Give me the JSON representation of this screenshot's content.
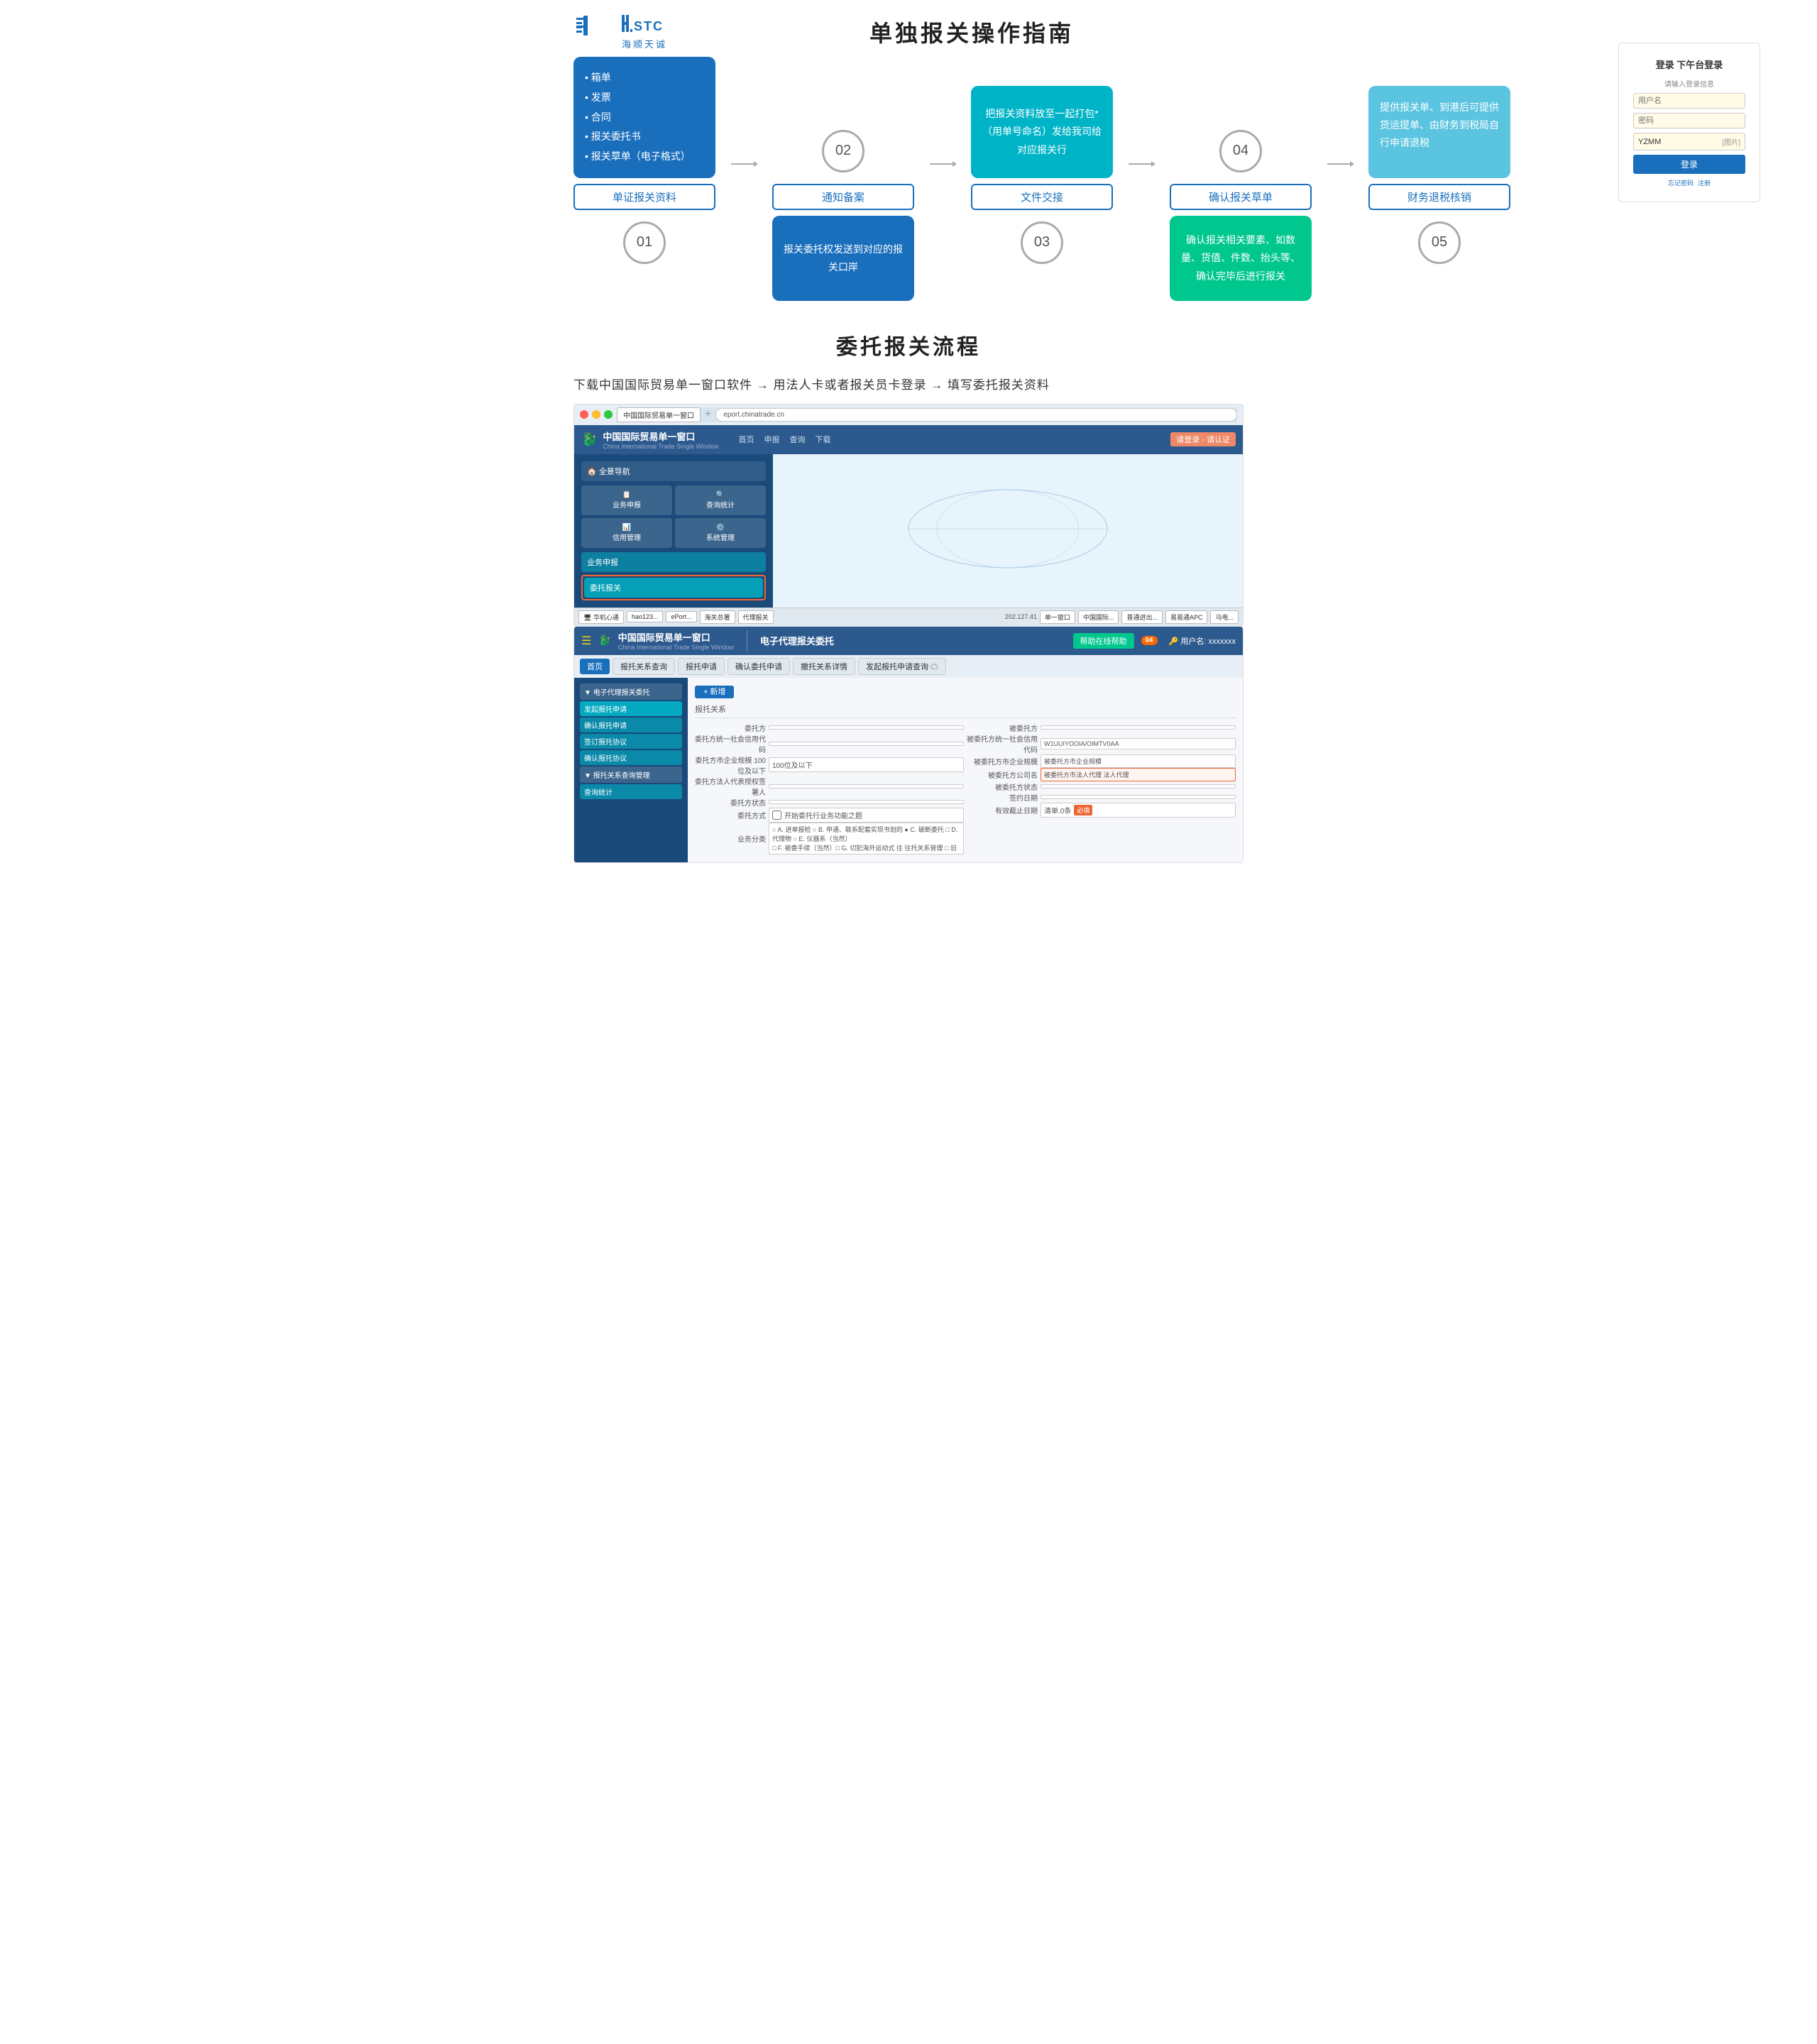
{
  "header": {
    "logo_stc": "H.STC",
    "logo_chinese": "海顺天诚",
    "main_title": "单独报关操作指南"
  },
  "flow": {
    "step1": {
      "num": "01",
      "label": "单证报关资料",
      "card_items": [
        "箱单",
        "发票",
        "合同",
        "报关委托书",
        "报关草单（电子格式）"
      ]
    },
    "step2": {
      "num": "02",
      "label": "通知备案",
      "card_text": "报关委托权发送到对应的报关口岸"
    },
    "step3": {
      "num": "03",
      "label": "文件交接",
      "card_text": "把报关资料放至一起打包*（用单号命名）发给我司给对应报关行"
    },
    "step4": {
      "num": "04",
      "label": "确认报关草单",
      "card_text": "确认报关相关要素、如数量、货值、件数、抬头等、确认完毕后进行报关"
    },
    "step5": {
      "num": "05",
      "label": "财务退税核销",
      "card_text": "提供报关单、到港后可提供货运提单、由财务到税局自行申请退税"
    }
  },
  "section2": {
    "title": "委托报关流程",
    "subtitle": "下载中国国际贸易单一窗口软件 → 用法人卡或者报关员卡登录 → 填写委托报关资料",
    "screen1": {
      "nav_title": "中国国际贸易单一窗口",
      "nav_subtitle": "China International Trade Single Window",
      "login_title": "登录登录 下午台登录",
      "field1_placeholder": "YZMM",
      "btn_text": "登录"
    },
    "screen2": {
      "nav_title": "中国国际贸易单一窗口",
      "nav_subtitle": "电子代理报关委托",
      "tab1": "首页",
      "tab2": "报托关系查询",
      "tab3": "报托申请",
      "tab4": "确认委托申请",
      "tab5": "撤托关系详情",
      "sidebar_section": "电子代理报关委托",
      "sidebar_item1": "发起报托申请",
      "sidebar_item2": "确认报托申请",
      "sidebar_item3": "签订报托协议",
      "sidebar_item4": "确认报托协议",
      "sidebar_item5": "报托关系查询管理",
      "sidebar_item6": "查询统计",
      "form_label1": "委托方统一社会信用代码",
      "form_label2": "委托方市企业规模 100位及以下",
      "form_label3": "委托方法人代表授权签署人",
      "form_label4": "委托方状态",
      "form_label5": "委托方式",
      "form_label6": "业务分类",
      "badge": "04"
    }
  }
}
